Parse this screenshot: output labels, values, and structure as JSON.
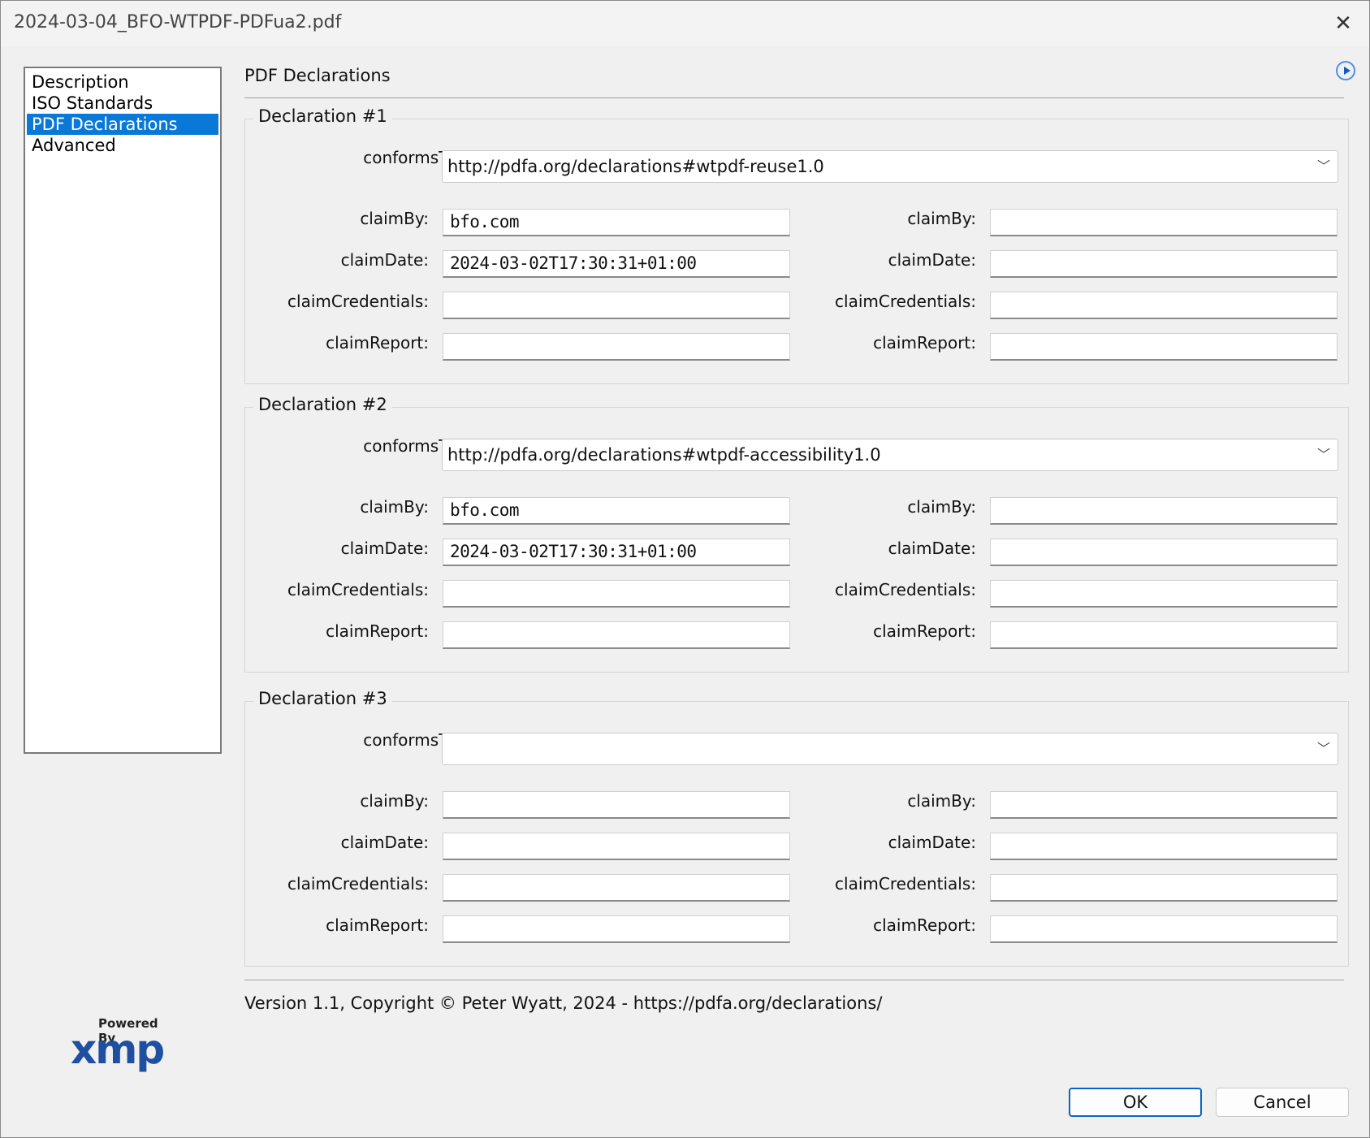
{
  "window": {
    "title": "2024-03-04_BFO-WTPDF-PDFua2.pdf",
    "close_glyph": "✕"
  },
  "nav": {
    "items": [
      {
        "label": "Description",
        "selected": false
      },
      {
        "label": "ISO Standards",
        "selected": false
      },
      {
        "label": "PDF Declarations",
        "selected": true
      },
      {
        "label": "Advanced",
        "selected": false
      }
    ]
  },
  "page": {
    "title": "PDF Declarations"
  },
  "labels": {
    "conforms_to": "conformsTo:",
    "claim_by": "claimBy:",
    "claim_date": "claimDate:",
    "claim_credentials": "claimCredentials:",
    "claim_report": "claimReport:"
  },
  "declarations": [
    {
      "legend": "Declaration #1",
      "conforms_to": "http://pdfa.org/declarations#wtpdf-reuse1.0",
      "left": {
        "claim_by": "bfo.com",
        "claim_date": "2024-03-02T17:30:31+01:00",
        "claim_credentials": "",
        "claim_report": ""
      },
      "right": {
        "claim_by": "",
        "claim_date": "",
        "claim_credentials": "",
        "claim_report": ""
      }
    },
    {
      "legend": "Declaration #2",
      "conforms_to": "http://pdfa.org/declarations#wtpdf-accessibility1.0",
      "left": {
        "claim_by": "bfo.com",
        "claim_date": "2024-03-02T17:30:31+01:00",
        "claim_credentials": "",
        "claim_report": ""
      },
      "right": {
        "claim_by": "",
        "claim_date": "",
        "claim_credentials": "",
        "claim_report": ""
      }
    },
    {
      "legend": "Declaration #3",
      "conforms_to": "",
      "left": {
        "claim_by": "",
        "claim_date": "",
        "claim_credentials": "",
        "claim_report": ""
      },
      "right": {
        "claim_by": "",
        "claim_date": "",
        "claim_credentials": "",
        "claim_report": ""
      }
    }
  ],
  "footer": {
    "version": "Version 1.1, Copyright © Peter Wyatt, 2024 - https://pdfa.org/declarations/"
  },
  "logo": {
    "powered_by": "Powered By",
    "brand": "xmp"
  },
  "buttons": {
    "ok": "OK",
    "cancel": "Cancel"
  },
  "colors": {
    "selection": "#0a78d7",
    "primary_border": "#0a64c8"
  }
}
